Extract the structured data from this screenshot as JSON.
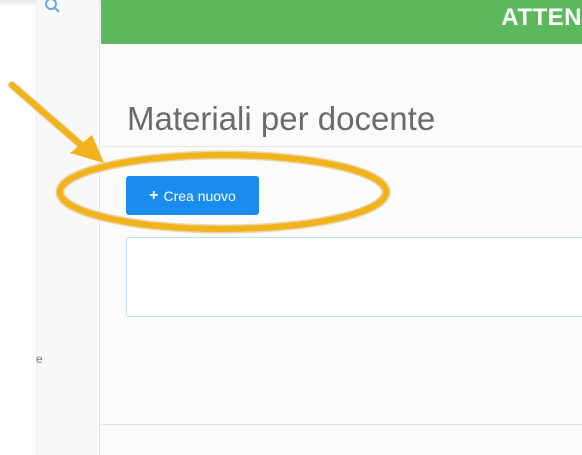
{
  "topbar": {
    "title": "ATTEN"
  },
  "page": {
    "title": "Materiali per docente"
  },
  "toolbar": {
    "create_label": "Crea nuovo",
    "create_icon": "plus-icon"
  },
  "sidebar": {
    "search_icon": "search-icon",
    "cropped_text": "e"
  },
  "colors": {
    "topbar": "#5cb85c",
    "primary_button": "#1a8cf0",
    "annotation": "#f2b21c"
  }
}
